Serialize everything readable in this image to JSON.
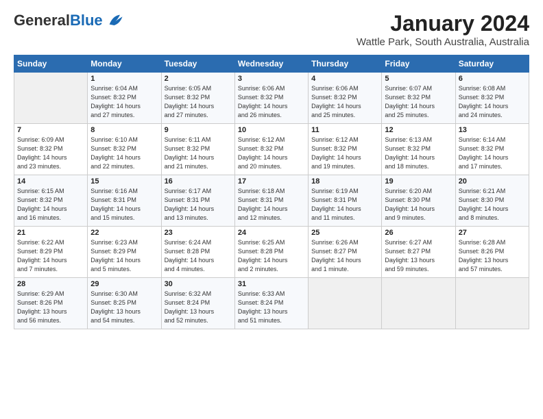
{
  "logo": {
    "general": "General",
    "blue": "Blue"
  },
  "title": "January 2024",
  "location": "Wattle Park, South Australia, Australia",
  "days_header": [
    "Sunday",
    "Monday",
    "Tuesday",
    "Wednesday",
    "Thursday",
    "Friday",
    "Saturday"
  ],
  "weeks": [
    [
      {
        "day": "",
        "info": ""
      },
      {
        "day": "1",
        "info": "Sunrise: 6:04 AM\nSunset: 8:32 PM\nDaylight: 14 hours\nand 27 minutes."
      },
      {
        "day": "2",
        "info": "Sunrise: 6:05 AM\nSunset: 8:32 PM\nDaylight: 14 hours\nand 27 minutes."
      },
      {
        "day": "3",
        "info": "Sunrise: 6:06 AM\nSunset: 8:32 PM\nDaylight: 14 hours\nand 26 minutes."
      },
      {
        "day": "4",
        "info": "Sunrise: 6:06 AM\nSunset: 8:32 PM\nDaylight: 14 hours\nand 25 minutes."
      },
      {
        "day": "5",
        "info": "Sunrise: 6:07 AM\nSunset: 8:32 PM\nDaylight: 14 hours\nand 25 minutes."
      },
      {
        "day": "6",
        "info": "Sunrise: 6:08 AM\nSunset: 8:32 PM\nDaylight: 14 hours\nand 24 minutes."
      }
    ],
    [
      {
        "day": "7",
        "info": "Sunrise: 6:09 AM\nSunset: 8:32 PM\nDaylight: 14 hours\nand 23 minutes."
      },
      {
        "day": "8",
        "info": "Sunrise: 6:10 AM\nSunset: 8:32 PM\nDaylight: 14 hours\nand 22 minutes."
      },
      {
        "day": "9",
        "info": "Sunrise: 6:11 AM\nSunset: 8:32 PM\nDaylight: 14 hours\nand 21 minutes."
      },
      {
        "day": "10",
        "info": "Sunrise: 6:12 AM\nSunset: 8:32 PM\nDaylight: 14 hours\nand 20 minutes."
      },
      {
        "day": "11",
        "info": "Sunrise: 6:12 AM\nSunset: 8:32 PM\nDaylight: 14 hours\nand 19 minutes."
      },
      {
        "day": "12",
        "info": "Sunrise: 6:13 AM\nSunset: 8:32 PM\nDaylight: 14 hours\nand 18 minutes."
      },
      {
        "day": "13",
        "info": "Sunrise: 6:14 AM\nSunset: 8:32 PM\nDaylight: 14 hours\nand 17 minutes."
      }
    ],
    [
      {
        "day": "14",
        "info": "Sunrise: 6:15 AM\nSunset: 8:32 PM\nDaylight: 14 hours\nand 16 minutes."
      },
      {
        "day": "15",
        "info": "Sunrise: 6:16 AM\nSunset: 8:31 PM\nDaylight: 14 hours\nand 15 minutes."
      },
      {
        "day": "16",
        "info": "Sunrise: 6:17 AM\nSunset: 8:31 PM\nDaylight: 14 hours\nand 13 minutes."
      },
      {
        "day": "17",
        "info": "Sunrise: 6:18 AM\nSunset: 8:31 PM\nDaylight: 14 hours\nand 12 minutes."
      },
      {
        "day": "18",
        "info": "Sunrise: 6:19 AM\nSunset: 8:31 PM\nDaylight: 14 hours\nand 11 minutes."
      },
      {
        "day": "19",
        "info": "Sunrise: 6:20 AM\nSunset: 8:30 PM\nDaylight: 14 hours\nand 9 minutes."
      },
      {
        "day": "20",
        "info": "Sunrise: 6:21 AM\nSunset: 8:30 PM\nDaylight: 14 hours\nand 8 minutes."
      }
    ],
    [
      {
        "day": "21",
        "info": "Sunrise: 6:22 AM\nSunset: 8:29 PM\nDaylight: 14 hours\nand 7 minutes."
      },
      {
        "day": "22",
        "info": "Sunrise: 6:23 AM\nSunset: 8:29 PM\nDaylight: 14 hours\nand 5 minutes."
      },
      {
        "day": "23",
        "info": "Sunrise: 6:24 AM\nSunset: 8:28 PM\nDaylight: 14 hours\nand 4 minutes."
      },
      {
        "day": "24",
        "info": "Sunrise: 6:25 AM\nSunset: 8:28 PM\nDaylight: 14 hours\nand 2 minutes."
      },
      {
        "day": "25",
        "info": "Sunrise: 6:26 AM\nSunset: 8:27 PM\nDaylight: 14 hours\nand 1 minute."
      },
      {
        "day": "26",
        "info": "Sunrise: 6:27 AM\nSunset: 8:27 PM\nDaylight: 13 hours\nand 59 minutes."
      },
      {
        "day": "27",
        "info": "Sunrise: 6:28 AM\nSunset: 8:26 PM\nDaylight: 13 hours\nand 57 minutes."
      }
    ],
    [
      {
        "day": "28",
        "info": "Sunrise: 6:29 AM\nSunset: 8:26 PM\nDaylight: 13 hours\nand 56 minutes."
      },
      {
        "day": "29",
        "info": "Sunrise: 6:30 AM\nSunset: 8:25 PM\nDaylight: 13 hours\nand 54 minutes."
      },
      {
        "day": "30",
        "info": "Sunrise: 6:32 AM\nSunset: 8:24 PM\nDaylight: 13 hours\nand 52 minutes."
      },
      {
        "day": "31",
        "info": "Sunrise: 6:33 AM\nSunset: 8:24 PM\nDaylight: 13 hours\nand 51 minutes."
      },
      {
        "day": "",
        "info": ""
      },
      {
        "day": "",
        "info": ""
      },
      {
        "day": "",
        "info": ""
      }
    ]
  ]
}
